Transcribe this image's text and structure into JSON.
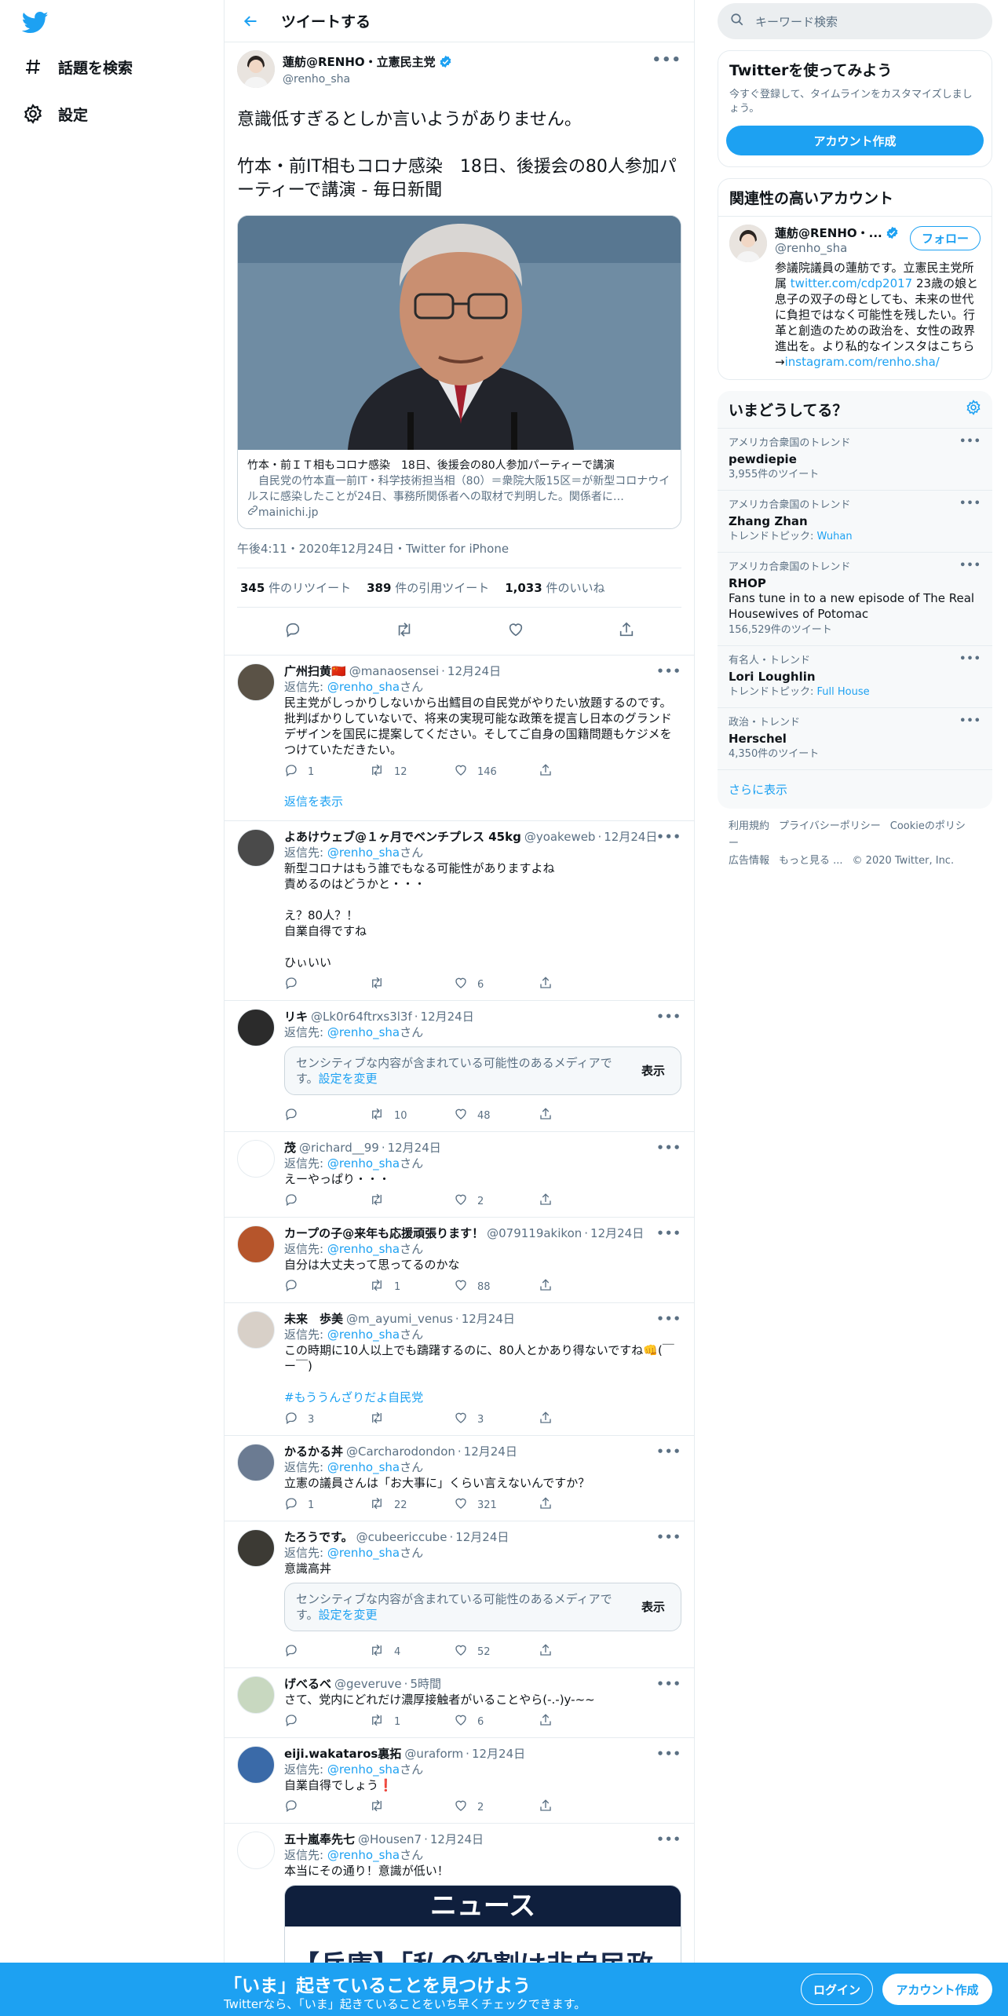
{
  "colors": {
    "accent": "#1da1f2",
    "secondary_text": "#5b7083",
    "border": "#e6ecf0",
    "like_red": "#e0245e"
  },
  "nav": {
    "explore": "話題を検索",
    "settings": "設定"
  },
  "header": {
    "title": "ツイートする"
  },
  "focal": {
    "name": "蓮舫@RENHO・立憲民主党",
    "handle": "@renho_sha",
    "line1": "意識低すぎるとしか言いようがありません。",
    "line2": "竹本・前IT相もコロナ感染　18日、後援会の80人参加パーティーで講演 - 毎日新聞",
    "card_title": "竹本・前ＩＴ相もコロナ感染　18日、後援会の80人参加パーティーで講演",
    "card_desc": "　自民党の竹本直一前IT・科学技術担当相（80）＝衆院大阪15区＝が新型コロナウイルスに感染したことが24日、事務所関係者への取材で判明した。関係者に…",
    "card_domain": "mainichi.jp",
    "meta": "午後4:11・2020年12月24日・Twitter for iPhone",
    "retweets_num": "345",
    "retweets_label": "件のリツイート",
    "quotes_num": "389",
    "quotes_label": "件の引用ツイート",
    "likes_num": "1,033",
    "likes_label": "件のいいね"
  },
  "reply_label": "返信先:",
  "reply_to_handle": "@renho_sha",
  "reply_suffix": "さん",
  "show_replies": "返信を表示",
  "sensitive": {
    "text": "センシティブな内容が含まれている可能性のあるメディアです。",
    "link": "設定を変更",
    "button": "表示"
  },
  "replies": [
    {
      "name": "广州扫黄🇨🇳",
      "handle": "@manaosensei",
      "time": "12月24日",
      "text": "民主党がしっかりしないから出鱈目の自民党がやりたい放題するのです。批判ばかりしていないで、将来の実現可能な政策を提言し日本のグランドデザインを国民に提案してください。そしてご自身の国籍問題もケジメをつけていただきたい。",
      "replies": "1",
      "retweets": "12",
      "likes": "146"
    },
    {
      "name": "よあけウェブ@１ヶ月でベンチプレス 45kg",
      "handle": "@yoakeweb",
      "time": "12月24日",
      "text": "新型コロナはもう誰でもなる可能性がありますよね\n責めるのはどうかと・・・\n\nえ？80人？！\n自業自得ですね\n\nひぃいい",
      "replies": "",
      "retweets": "",
      "likes": "6"
    },
    {
      "name": "リキ",
      "handle": "@Lk0r64ftrxs3l3f",
      "time": "12月24日",
      "text": "",
      "replies": "",
      "retweets": "10",
      "likes": "48"
    },
    {
      "name": "茂",
      "handle": "@richard__99",
      "time": "12月24日",
      "text": "えーやっぱり・・・",
      "replies": "",
      "retweets": "",
      "likes": "2"
    },
    {
      "name": "カープの子@来年も応援頑張ります！",
      "handle": "@079119akikon",
      "time": "12月24日",
      "text": "自分は大丈夫って思ってるのかな",
      "replies": "",
      "retweets": "1",
      "likes": "88"
    },
    {
      "name": "未来　歩美",
      "handle": "@m_ayumi_venus",
      "time": "12月24日",
      "text": "この時期に10人以上でも躊躇するのに、80人とかあり得ないですね👊(￣ー￣)",
      "hashtag": "#もううんざりだよ自民党",
      "replies": "3",
      "retweets": "",
      "likes": "3"
    },
    {
      "name": "かるかる丼",
      "handle": "@Carcharodondon",
      "time": "12月24日",
      "text": "立憲の議員さんは「お大事に」くらい言えないんですか？",
      "replies": "1",
      "retweets": "22",
      "likes": "321"
    },
    {
      "name": "たろうです。",
      "handle": "@cubeericcube",
      "time": "12月24日",
      "text": "意識高丼",
      "replies": "",
      "retweets": "4",
      "likes": "52"
    },
    {
      "name": "げべるべ",
      "handle": "@geveruve",
      "time": "5時間",
      "text": "さて、党内にどれだけ濃厚接触者がいることやら(-.-)y-~~",
      "replies": "",
      "retweets": "1",
      "likes": "6"
    },
    {
      "name": "eiji.wakataros裏拓",
      "handle": "@uraform",
      "time": "12月24日",
      "text": "自業自得でしょう❗",
      "replies": "",
      "retweets": "",
      "likes": "2"
    },
    {
      "name": "五十嵐奉先七",
      "handle": "@Housen7",
      "time": "12月24日",
      "text": "本当にその通り！意識が低い！",
      "media_title": "ニュース",
      "media_sub": "【兵庫】「私の役割は非自民政"
    }
  ],
  "right": {
    "search_placeholder": "キーワード検索",
    "join_title": "Twitterを使ってみよう",
    "join_sub": "今すぐ登録して、タイムラインをカスタマイズしましょう。",
    "join_button": "アカウント作成",
    "relevant_title": "関連性の高いアカウント",
    "rel_name": "蓮舫@RENHO・...",
    "rel_handle": "@renho_sha",
    "rel_follow": "フォロー",
    "rel_bio_1": "参議院議員の蓮舫です。立憲民主党所属",
    "rel_bio_link": "twitter.com/cdp2017",
    "rel_bio_2": "23歳の娘と息子の双子の母としても、未来の世代に負担ではなく可能性を残したい。行革と創造のための政治を、女性の政界進出を。より私的なインスタはこちら→",
    "rel_bio_link2": "instagram.com/renho.sha/",
    "trends_title": "いまどうしてる？",
    "trends": [
      {
        "context": "アメリカ合衆国のトレンド",
        "name": "pewdiepie",
        "meta": "3,955件のツイート"
      },
      {
        "context": "アメリカ合衆国のトレンド",
        "name": "Zhang Zhan",
        "topic_label": "トレンドトピック:",
        "topic": "Wuhan"
      },
      {
        "context": "アメリカ合衆国のトレンド",
        "name": "RHOP",
        "desc": "Fans tune in to a new episode of The Real Housewives of Potomac",
        "meta": "156,529件のツイート"
      },
      {
        "context": "有名人・トレンド",
        "name": "Lori Loughlin",
        "topic_label": "トレンドトピック:",
        "topic": "Full House"
      },
      {
        "context": "政治・トレンド",
        "name": "Herschel",
        "meta": "4,350件のツイート"
      }
    ],
    "show_more": "さらに表示",
    "footer": [
      "利用規約",
      "プライバシーポリシー",
      "Cookieのポリシー",
      "広告情報",
      "もっと見る ...",
      "© 2020 Twitter, Inc."
    ]
  },
  "bottom": {
    "title": "「いま」起きていることを見つけよう",
    "sub": "Twitterなら、「いま」起きていることをいち早くチェックできます。",
    "login": "ログイン",
    "signup": "アカウント作成"
  }
}
